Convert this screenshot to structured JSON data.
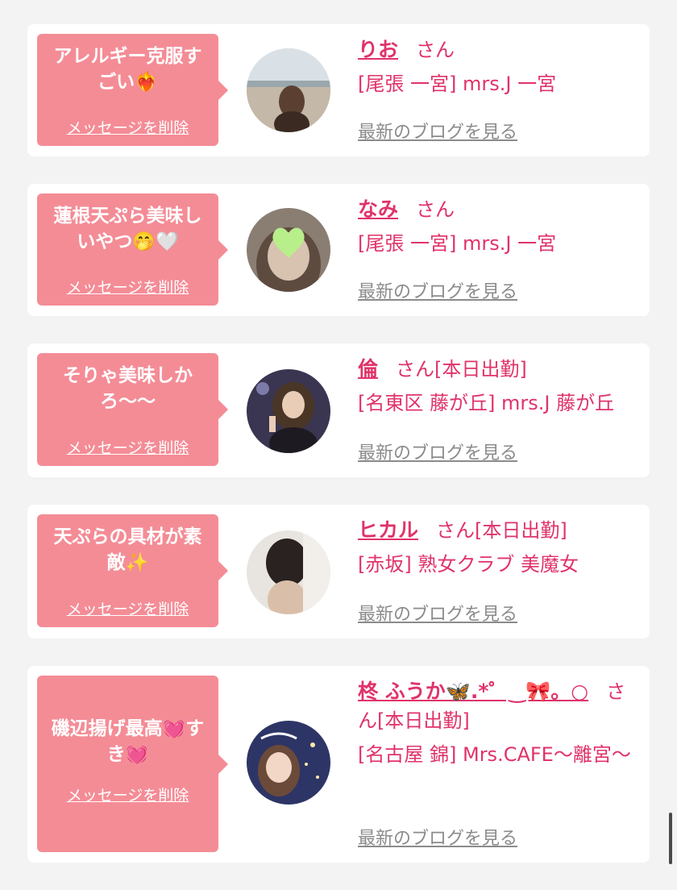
{
  "colors": {
    "bubble": "#f48c96",
    "accent": "#e0336a",
    "blog_link": "#8b8b8b",
    "card_bg": "#ffffff",
    "page_bg": "#f3f3f3"
  },
  "delete_label": "メッセージを削除",
  "san_label": "さん",
  "blog_label": "最新のブログを見る",
  "cards": [
    {
      "message": "アレルギー克服すごい❤️‍🔥",
      "name": "りお",
      "tag": "",
      "shop": "[尾張 一宮] mrs.J 一宮"
    },
    {
      "message": "蓮根天ぷら美味しいやつ🤭🤍",
      "name": "なみ",
      "tag": "",
      "shop": "[尾張 一宮] mrs.J 一宮"
    },
    {
      "message": "そりゃ美味しかろ〜〜",
      "name": "倫",
      "tag": "[本日出勤]",
      "shop": "[名東区 藤が丘] mrs.J 藤が丘"
    },
    {
      "message": "天ぷらの具材が素敵✨",
      "name": "ヒカル",
      "tag": "[本日出勤]",
      "shop": "[赤坂] 熟女クラブ 美魔女"
    },
    {
      "message": "磯辺揚げ最高💓すき💓",
      "name": "柊 ふうか🦋.*゜‿🎀。○",
      "tag": "[本日出勤]",
      "shop": "[名古屋 錦] Mrs.CAFE〜離宮〜"
    }
  ]
}
